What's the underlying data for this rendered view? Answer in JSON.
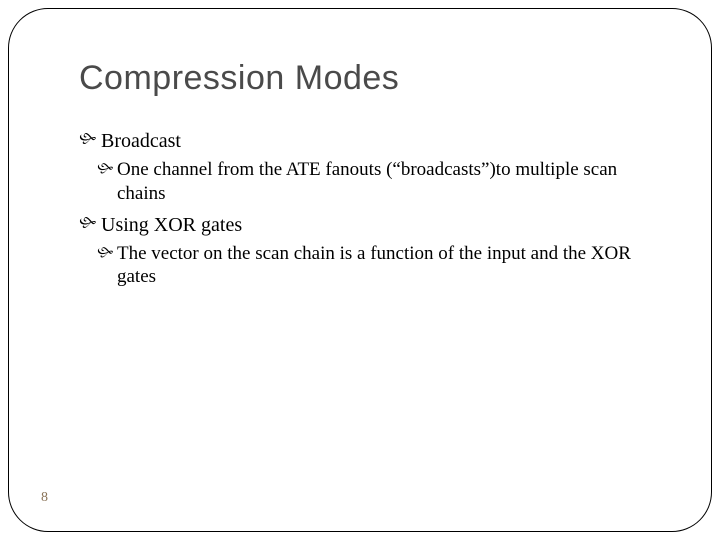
{
  "slide": {
    "title": "Compression Modes",
    "bullets": [
      {
        "text": "Broadcast",
        "sub": [
          "One channel from the ATE fanouts (“broadcasts”)to multiple scan chains"
        ]
      },
      {
        "text": "Using XOR gates",
        "sub": [
          "The vector on the scan chain is a function of the input and the XOR gates"
        ]
      }
    ],
    "page_number": "8"
  }
}
